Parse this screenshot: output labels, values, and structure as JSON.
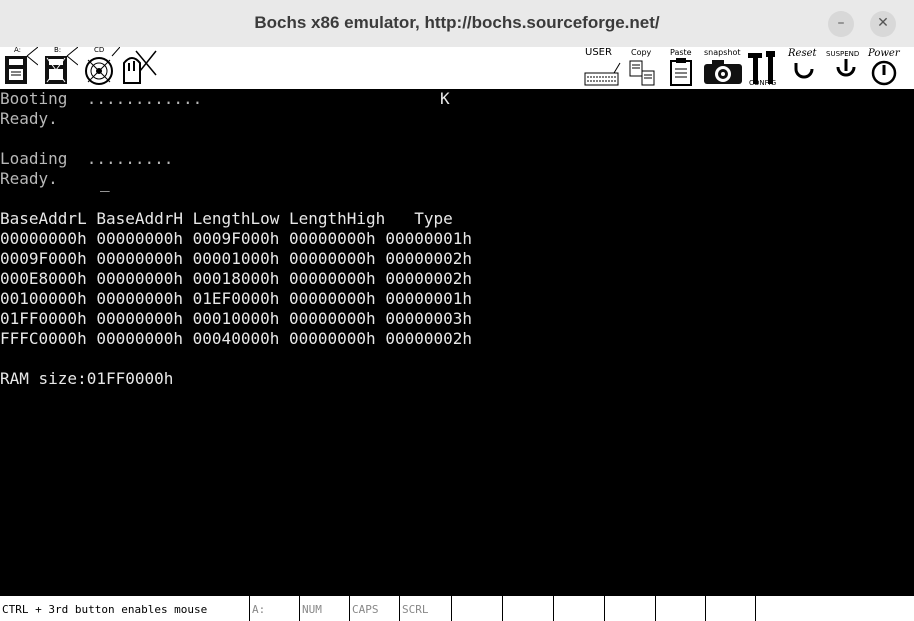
{
  "window": {
    "title": "Bochs x86 emulator, http://bochs.sourceforge.net/",
    "minimize_label": "–",
    "close_label": "✕"
  },
  "toolbar": {
    "floppy_a": "A:",
    "floppy_b": "B:",
    "cdrom": "CD",
    "user": "USER",
    "copy": "Copy",
    "paste": "Paste",
    "snapshot": "snapshot",
    "config": "CONFIG",
    "reset": "Reset",
    "suspend": "SUSPEND",
    "power": "Power"
  },
  "screen": {
    "booting": "Booting  ............",
    "k_char": "K",
    "ready1": "Ready.",
    "loading": "Loading  .........",
    "ready2": "Ready.",
    "cursor": "_",
    "header": "BaseAddrL BaseAddrH LengthLow LengthHigh   Type",
    "rows": [
      "00000000h 00000000h 0009F000h 00000000h 00000001h",
      "0009F000h 00000000h 00001000h 00000000h 00000002h",
      "000E8000h 00000000h 00018000h 00000000h 00000002h",
      "00100000h 00000000h 01EF0000h 00000000h 00000001h",
      "01FF0000h 00000000h 00010000h 00000000h 00000003h",
      "FFFC0000h 00000000h 00040000h 00000000h 00000002h"
    ],
    "ram_size": "RAM size:01FF0000h"
  },
  "status": {
    "hint": "CTRL + 3rd button enables mouse",
    "drive": "A:",
    "num": "NUM",
    "caps": "CAPS",
    "scrl": "SCRL"
  }
}
